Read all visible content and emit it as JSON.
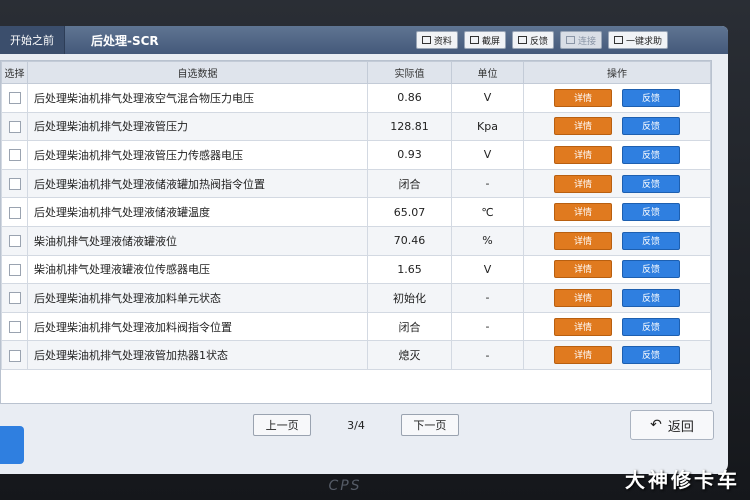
{
  "header": {
    "home_tab": "开始之前",
    "page_title": "后处理-SCR",
    "toolbar": [
      {
        "label": "资料",
        "icon": "document-icon",
        "enabled": true
      },
      {
        "label": "截屏",
        "icon": "camera-icon",
        "enabled": true
      },
      {
        "label": "反馈",
        "icon": "edit-icon",
        "enabled": true
      },
      {
        "label": "连接",
        "icon": "link-icon",
        "enabled": false
      },
      {
        "label": "一键求助",
        "icon": "help-icon",
        "enabled": true
      }
    ]
  },
  "table": {
    "headers": {
      "select": "选择",
      "name": "自选数据",
      "value": "实际值",
      "unit": "单位",
      "ops": "操作"
    },
    "detail_label": "详情",
    "feedback_label": "反馈",
    "rows": [
      {
        "name": "后处理柴油机排气处理液空气混合物压力电压",
        "value": "0.86",
        "unit": "V"
      },
      {
        "name": "后处理柴油机排气处理液管压力",
        "value": "128.81",
        "unit": "Kpa"
      },
      {
        "name": "后处理柴油机排气处理液管压力传感器电压",
        "value": "0.93",
        "unit": "V"
      },
      {
        "name": "后处理柴油机排气处理液储液罐加热阀指令位置",
        "value": "闭合",
        "unit": "-"
      },
      {
        "name": "后处理柴油机排气处理液储液罐温度",
        "value": "65.07",
        "unit": "℃"
      },
      {
        "name": "柴油机排气处理液储液罐液位",
        "value": "70.46",
        "unit": "%"
      },
      {
        "name": "柴油机排气处理液罐液位传感器电压",
        "value": "1.65",
        "unit": "V"
      },
      {
        "name": "后处理柴油机排气处理液加料单元状态",
        "value": "初始化",
        "unit": "-"
      },
      {
        "name": "后处理柴油机排气处理液加料阀指令位置",
        "value": "闭合",
        "unit": "-"
      },
      {
        "name": "后处理柴油机排气处理液管加热器1状态",
        "value": "熄灭",
        "unit": "-"
      }
    ]
  },
  "pager": {
    "prev": "上一页",
    "page": "3/4",
    "next": "下一页"
  },
  "back_label": "返回",
  "device_logo": "CPS",
  "watermark": "大神修卡车"
}
